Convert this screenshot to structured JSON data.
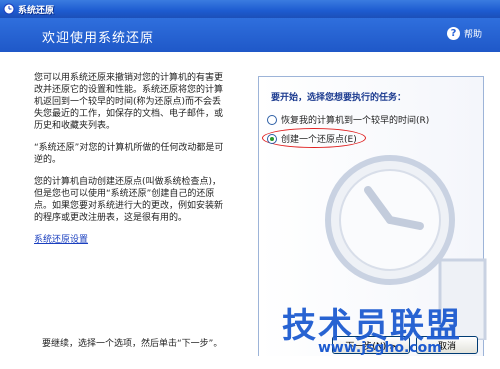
{
  "window": {
    "title": "系统还原"
  },
  "header": {
    "heading": "欢迎使用系统还原",
    "help_label": "帮助",
    "help_symbol": "?"
  },
  "left": {
    "para1": "您可以用系统还原来撤销对您的计算机的有害更改并还原它的设置和性能。系统还原将您的计算机返回到一个较早的时间(称为还原点)而不会丢失您最近的工作，如保存的文档、电子邮件，或历史和收藏夹列表。",
    "para2": "“系统还原”对您的计算机所做的任何改动都是可逆的。",
    "para3": "您的计算机自动创建还原点(叫做系统检查点)，但是您也可以使用“系统还原”创建自己的还原点。如果您要对系统进行大的更改，例如安装新的程序或更改注册表，这是很有用的。",
    "settings_link": "系统还原设置",
    "bottom_text": "要继续，选择一个选项，然后单击“下一步”。"
  },
  "right": {
    "task_title": "要开始，选择您想要执行的任务：",
    "options": [
      {
        "label": "恢复我的计算机到一个较早的时间(R)",
        "checked": false
      },
      {
        "label": "创建一个还原点(E)",
        "checked": true
      }
    ]
  },
  "buttons": {
    "next": "下一步(N) >",
    "cancel": "取消"
  },
  "watermark": {
    "main": "技术员联盟",
    "url": "www.jsgho.com"
  }
}
